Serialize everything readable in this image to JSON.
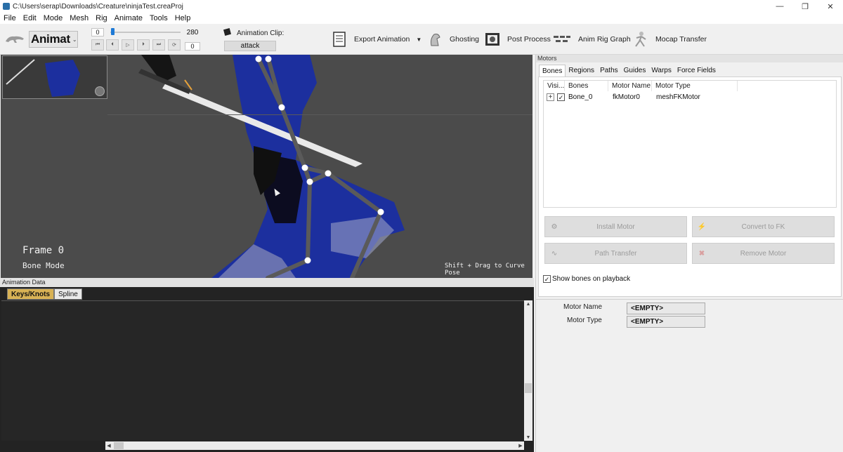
{
  "window": {
    "title": "C:\\Users\\serap\\Downloads\\Creature\\ninjaTest.creaProj"
  },
  "menu": [
    "File",
    "Edit",
    "Mode",
    "Mesh",
    "Rig",
    "Animate",
    "Tools",
    "Help"
  ],
  "toolbar": {
    "mode": "Animat",
    "start_frame": "0",
    "end_frame": "280",
    "current_frame": "0",
    "slider_position": 0.0,
    "clip_label": "Animation Clip:",
    "clip_value": "attack",
    "tools": [
      "Export Animation",
      "Ghosting",
      "Post Process",
      "Anim Rig Graph",
      "Mocap Transfer"
    ]
  },
  "viewport": {
    "frame_text": "Frame 0",
    "mode_text": "Bone Mode",
    "hint_text": "Shift + Drag to Curve Pose"
  },
  "animation_data": {
    "header": "Animation Data",
    "tabs": [
      "Keys/Knots",
      "Spline"
    ]
  },
  "motors": {
    "header": "Motors",
    "tabs": [
      "Bones",
      "Regions",
      "Paths",
      "Guides",
      "Warps",
      "Force Fields"
    ],
    "columns": [
      "Visi...",
      "Bones",
      "Motor Name",
      "Motor Type"
    ],
    "rows": [
      {
        "bone": "Bone_0",
        "motor_name": "fkMotor0",
        "motor_type": "meshFKMotor",
        "visible": true
      }
    ],
    "buttons": [
      "Install Motor",
      "Convert to FK",
      "Path Transfer",
      "Remove Motor"
    ],
    "show_bones_label": "Show bones on playback",
    "show_bones_checked": true,
    "fields": {
      "motor_name_label": "Motor Name",
      "motor_name_value": "<EMPTY>",
      "motor_type_label": "Motor Type",
      "motor_type_value": "<EMPTY>"
    }
  },
  "colors": {
    "viewport_bg": "#4b4b4b",
    "anim_bg": "#232323",
    "active_tab": "#d8b255",
    "ninja_blue": "#1c2f9e",
    "accent_blue": "#1e7ad6"
  }
}
